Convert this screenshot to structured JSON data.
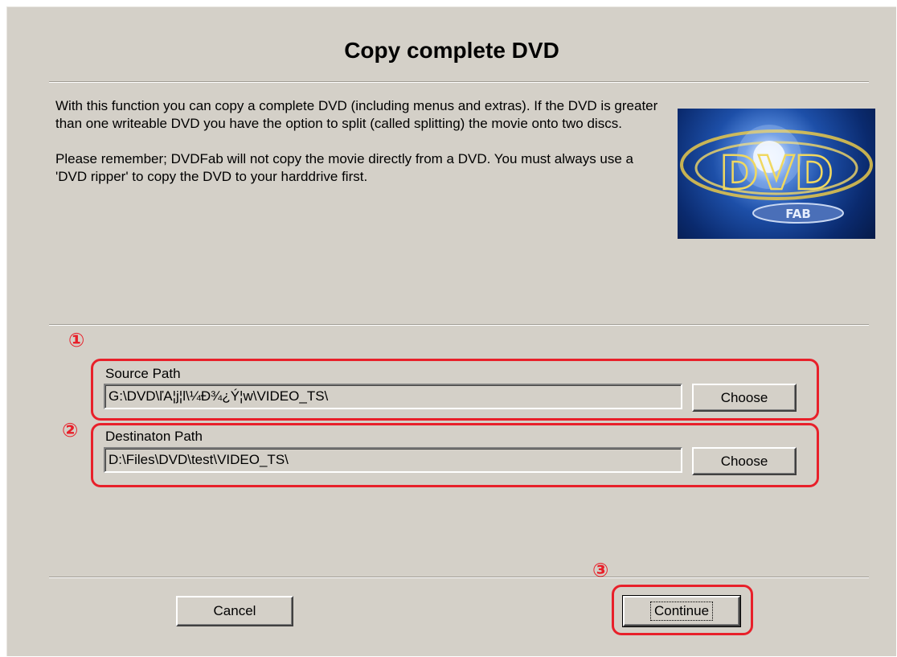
{
  "dialog": {
    "title": "Copy complete DVD",
    "description_1": "With this function you can copy a complete DVD (including menus and extras). If the DVD is greater than one writeable DVD you have the option to split (called splitting) the movie onto two discs.",
    "description_2": "Please remember; DVDFab will not copy the movie directly from a DVD. You must always use a 'DVD ripper' to copy the DVD to your harddrive first.",
    "logo_text": "FAB",
    "logo_letters": "DVD"
  },
  "source": {
    "label": "Source Path",
    "value": "G:\\DVD\\ľA¦j¦l\\¼Ð¾¿Ý¦w\\VIDEO_TS\\",
    "choose_label": "Choose"
  },
  "destination": {
    "label": "Destinaton Path",
    "value": "D:\\Files\\DVD\\test\\VIDEO_TS\\",
    "choose_label": "Choose"
  },
  "footer": {
    "cancel_label": "Cancel",
    "continue_label": "Continue"
  },
  "annotations": {
    "marker_1": "①",
    "marker_2": "②",
    "marker_3": "③",
    "color": "#e8202a"
  }
}
